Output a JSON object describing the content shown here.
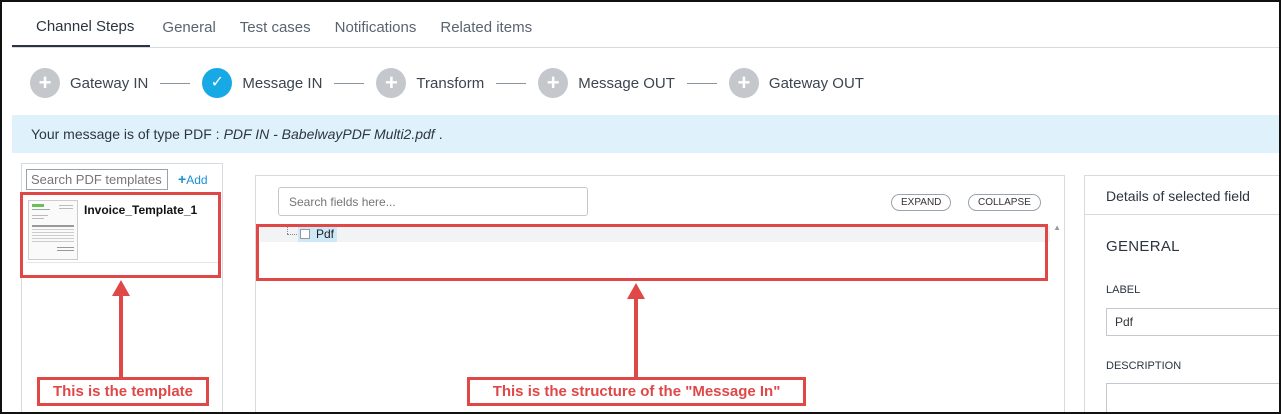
{
  "tabs": [
    {
      "label": "Channel Steps"
    },
    {
      "label": "General"
    },
    {
      "label": "Test cases"
    },
    {
      "label": "Notifications"
    },
    {
      "label": "Related items"
    }
  ],
  "steps": [
    {
      "label": "Gateway IN",
      "state": "pending",
      "icon": "+"
    },
    {
      "label": "Message IN",
      "state": "active",
      "icon": "✓"
    },
    {
      "label": "Transform",
      "state": "pending",
      "icon": "+"
    },
    {
      "label": "Message OUT",
      "state": "pending",
      "icon": "+"
    },
    {
      "label": "Gateway OUT",
      "state": "pending",
      "icon": "+"
    }
  ],
  "info": {
    "prefix": "Your message is of type PDF :",
    "filename": "PDF IN - BabelwayPDF Multi2.pdf",
    "suffix": "."
  },
  "left_panel": {
    "search_placeholder": "Search PDF templates...",
    "add_label": "Add",
    "template_name": "Invoice_Template_1"
  },
  "center_panel": {
    "search_placeholder": "Search fields here...",
    "expand_label": "EXPAND",
    "collapse_label": "COLLAPSE",
    "tree_root": "Pdf"
  },
  "right_panel": {
    "header": "Details of selected field",
    "section": "GENERAL",
    "label_title": "LABEL",
    "label_value": "Pdf",
    "description_title": "DESCRIPTION"
  },
  "annotations": {
    "template_note": "This is the template",
    "structure_note": "This is the structure of the \"Message In\""
  },
  "colors": {
    "accent": "#16a9e6",
    "annotation": "#e04848",
    "infobar": "#dff1fb"
  }
}
